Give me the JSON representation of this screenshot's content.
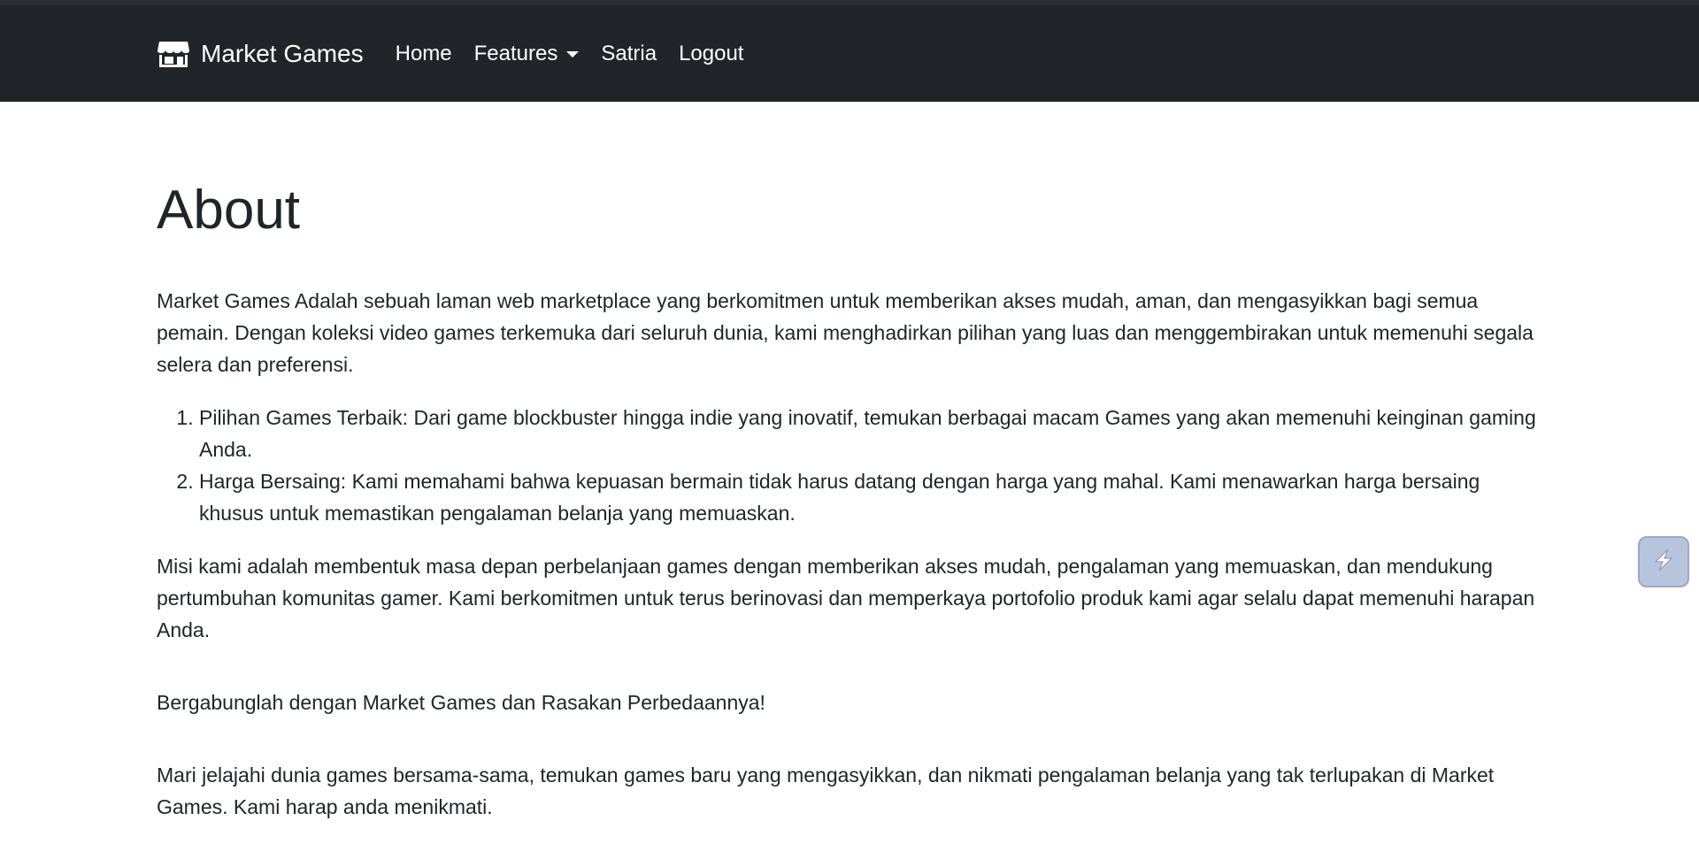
{
  "nav": {
    "brand": "Market Games",
    "links": {
      "home": "Home",
      "features": "Features",
      "user": "Satria",
      "logout": "Logout"
    }
  },
  "about": {
    "title": "About",
    "intro": "Market Games Adalah sebuah laman web marketplace yang berkomitmen untuk memberikan akses mudah, aman, dan mengasyikkan bagi semua pemain. Dengan koleksi video games terkemuka dari seluruh dunia, kami menghadirkan pilihan yang luas dan menggembirakan untuk memenuhi segala selera dan preferensi.",
    "list": [
      "Pilihan Games Terbaik: Dari game blockbuster hingga indie yang inovatif, temukan berbagai macam Games yang akan memenuhi keinginan gaming Anda.",
      "Harga Bersaing: Kami memahami bahwa kepuasan bermain tidak harus datang dengan harga yang mahal. Kami menawarkan harga bersaing khusus untuk memastikan pengalaman belanja yang memuaskan."
    ],
    "mission": "Misi kami adalah membentuk masa depan perbelanjaan games dengan memberikan akses mudah, pengalaman yang memuaskan, dan mendukung pertumbuhan komunitas gamer. Kami berkomitmen untuk terus berinovasi dan memperkaya portofolio produk kami agar selalu dapat memenuhi harapan Anda.",
    "cta": "Bergabunglah dengan Market Games dan Rasakan Perbedaannya!",
    "closing": "Mari jelajahi dunia games bersama-sama, temukan games baru yang mengasyikkan, dan nikmati pengalaman belanja yang tak terlupakan di Market Games. Kami harap anda menikmati."
  },
  "icons": {
    "brand": "shop-icon",
    "dropdown": "caret-down-icon",
    "floating": "lightning-icon"
  },
  "colors": {
    "navbar": "#212529",
    "text": "#212529",
    "float_button": "#b8c4dc"
  }
}
